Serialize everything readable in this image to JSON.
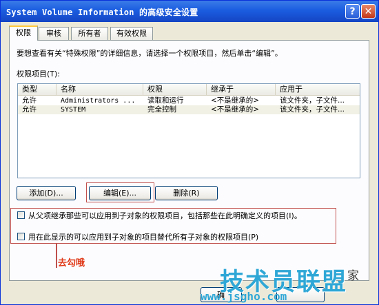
{
  "window": {
    "title": "System Volume Information 的高级安全设置",
    "help_glyph": "?",
    "close_glyph": "✕"
  },
  "tabs": [
    {
      "label": "权限",
      "active": true
    },
    {
      "label": "审核",
      "active": false
    },
    {
      "label": "所有者",
      "active": false
    },
    {
      "label": "有效权限",
      "active": false
    }
  ],
  "permissions": {
    "description": "要想查看有关“特殊权限”的详细信息，请选择一个权限项目，然后单击“编辑”。",
    "list_label": "权限项目(T):",
    "columns": [
      "类型",
      "名称",
      "权限",
      "继承于",
      "应用于"
    ],
    "rows": [
      {
        "type": "允许",
        "name": "Administrators ...",
        "permission": "读取和运行",
        "inherited_from": "<不是继承的>",
        "applies_to": "该文件夹，子文件..."
      },
      {
        "type": "允许",
        "name": "SYSTEM",
        "permission": "完全控制",
        "inherited_from": "<不是继承的>",
        "applies_to": "该文件夹，子文件..."
      }
    ]
  },
  "buttons": {
    "add": "添加(D)...",
    "edit": "编辑(E)...",
    "remove": "删除(R)"
  },
  "checkboxes": [
    {
      "label": "从父项继承那些可以应用到子对象的权限项目，包括那些在此明确定义的项目(I)。",
      "checked": false
    },
    {
      "label": "用在此显示的可以应用到子对象的项目替代所有子对象的权限项目(P)",
      "checked": false
    }
  ],
  "annotation": {
    "text": "去勾哦",
    "color": "#e03a1a"
  },
  "footer": {
    "ok_partial": "确"
  },
  "watermark": {
    "brand": "技术员联盟",
    "suffix": "家",
    "url": "www.jsgho.com"
  },
  "colors": {
    "title_bar": "#1b5de0",
    "highlight_box": "#c0504d",
    "watermark": "#2fa7d6"
  }
}
